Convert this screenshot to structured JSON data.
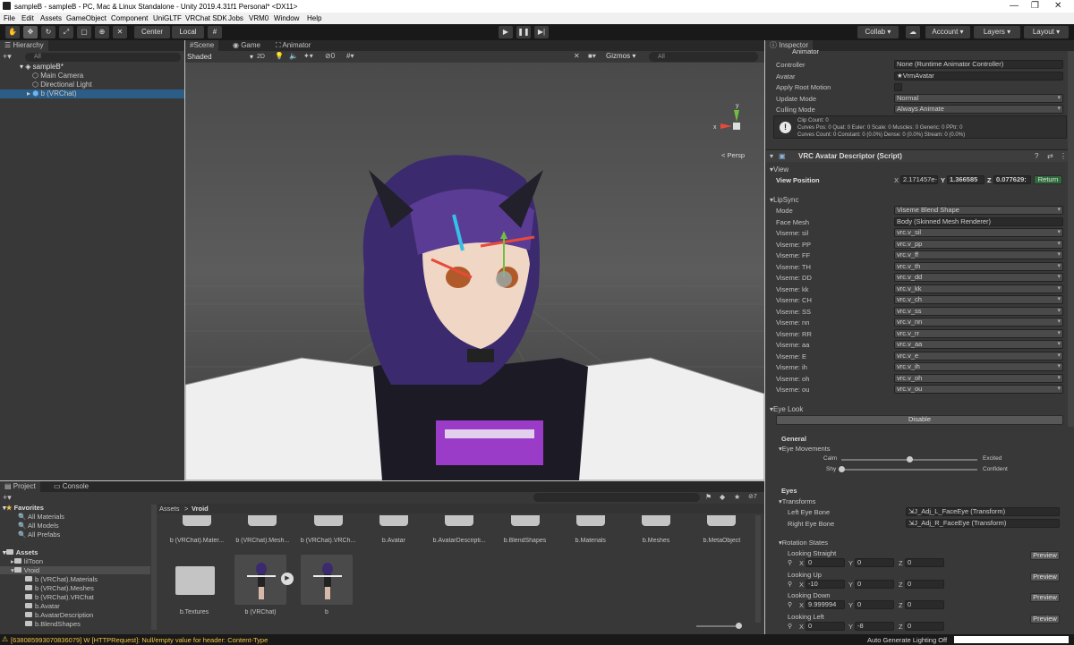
{
  "window": {
    "title": "sampleB - sampleB - PC, Mac & Linux Standalone - Unity 2019.4.31f1 Personal* <DX11>"
  },
  "menu": [
    "File",
    "Edit",
    "Assets",
    "GameObject",
    "Component",
    "UniGLTF",
    "VRChat SDK",
    "Jobs",
    "VRM0",
    "Window",
    "Help"
  ],
  "toolbar": {
    "center": "Center",
    "local": "Local",
    "collab": "Collab ▾",
    "account": "Account",
    "layers": "Layers",
    "layout": "Layout"
  },
  "hierarchy": {
    "tab": "Hierarchy",
    "search_placeholder": "All",
    "scene": "sampleB*",
    "items": [
      "Main Camera",
      "Directional Light",
      "b (VRChat)"
    ]
  },
  "scene_view": {
    "tabs": [
      "Scene",
      "Game",
      "Animator"
    ],
    "shading": "Shaded",
    "mode_2d": "2D",
    "layers_count": "0",
    "gizmos": "Gizmos",
    "search_placeholder": "All",
    "persp": "< Persp",
    "axis_y": "y",
    "axis_x": "x"
  },
  "inspector": {
    "tab": "Inspector",
    "animator_header": "Animator",
    "animator": [
      {
        "label": "Controller",
        "value": "None (Runtime Animator Controller)"
      },
      {
        "label": "Avatar",
        "value": "VrmAvatar"
      },
      {
        "label": "Apply Root Motion",
        "value": ""
      },
      {
        "label": "Update Mode",
        "value": "Normal"
      },
      {
        "label": "Culling Mode",
        "value": "Always Animate"
      }
    ],
    "info_lines": [
      "Clip Count: 0",
      "Curves Pos: 0 Quat: 0 Euler: 0 Scale: 0 Muscles: 0 Generic: 0 PPtr: 0",
      "Curves Count: 0 Constant: 0 (0.0%) Dense: 0 (0.0%) Stream: 0 (0.0%)"
    ],
    "descriptor_title": "VRC Avatar Descriptor (Script)",
    "view_section": "View",
    "view_position_label": "View Position",
    "view_position": {
      "x": "2.171457e-",
      "y": "1.366585",
      "z": "0.077629:"
    },
    "return_label": "Return",
    "lipsync_section": "LipSync",
    "lipsync": [
      {
        "label": "Mode",
        "value": "Viseme Blend Shape"
      },
      {
        "label": "Face Mesh",
        "value": "Body (Skinned Mesh Renderer)"
      },
      {
        "label": "Viseme: sil",
        "value": "vrc.v_sil"
      },
      {
        "label": "Viseme: PP",
        "value": "vrc.v_pp"
      },
      {
        "label": "Viseme: FF",
        "value": "vrc.v_ff"
      },
      {
        "label": "Viseme: TH",
        "value": "vrc.v_th"
      },
      {
        "label": "Viseme: DD",
        "value": "vrc.v_dd"
      },
      {
        "label": "Viseme: kk",
        "value": "vrc.v_kk"
      },
      {
        "label": "Viseme: CH",
        "value": "vrc.v_ch"
      },
      {
        "label": "Viseme: SS",
        "value": "vrc.v_ss"
      },
      {
        "label": "Viseme: nn",
        "value": "vrc.v_nn"
      },
      {
        "label": "Viseme: RR",
        "value": "vrc.v_rr"
      },
      {
        "label": "Viseme: aa",
        "value": "vrc.v_aa"
      },
      {
        "label": "Viseme: E",
        "value": "vrc.v_e"
      },
      {
        "label": "Viseme: ih",
        "value": "vrc.v_ih"
      },
      {
        "label": "Viseme: oh",
        "value": "vrc.v_oh"
      },
      {
        "label": "Viseme: ou",
        "value": "vrc.v_ou"
      }
    ],
    "eyelook_section": "Eye Look",
    "disable_label": "Disable",
    "general_label": "General",
    "eye_movements_label": "Eye Movements",
    "calm": "Calm",
    "excited": "Excited",
    "shy": "Shy",
    "confident": "Confident",
    "calm_excited_value": 0.5,
    "shy_confident_value": 0.0,
    "eyes_label": "Eyes",
    "transforms_label": "Transforms",
    "left_eye_label": "Left Eye Bone",
    "left_eye_value": "J_Adj_L_FaceEye (Transform)",
    "right_eye_label": "Right Eye Bone",
    "right_eye_value": "J_Adj_R_FaceEye (Transform)",
    "rotation_states_label": "Rotation States",
    "rotation_states": [
      {
        "label": "Looking Straight",
        "x": "0",
        "y": "0",
        "z": "0"
      },
      {
        "label": "Looking Up",
        "x": "-10",
        "y": "0",
        "z": "0"
      },
      {
        "label": "Looking Down",
        "x": "9.999994",
        "y": "0",
        "z": "0"
      },
      {
        "label": "Looking Left",
        "x": "0",
        "y": "-8",
        "z": "0"
      }
    ],
    "preview_label": "Preview"
  },
  "project": {
    "tabs": [
      "Project",
      "Console"
    ],
    "favorites": "Favorites",
    "fav_items": [
      "All Materials",
      "All Models",
      "All Prefabs"
    ],
    "assets": "Assets",
    "tree": [
      "lilToon",
      "Vroid",
      "b (VRChat).Materials",
      "b (VRChat).Meshes",
      "b (VRChat).VRChat",
      "b.Avatar",
      "b.AvatarDescription",
      "b.BlendShapes"
    ],
    "breadcrumb_root": "Assets",
    "breadcrumb_leaf": "Vroid",
    "hidden_count": "7",
    "top_row": [
      "b (VRChat).Mater...",
      "b (VRChat).Mesh...",
      "b (VRChat).VRCh...",
      "b.Avatar",
      "b.AvatarDescripti...",
      "b.BlendShapes",
      "b.Materials",
      "b.Meshes",
      "b.MetaObject"
    ],
    "bottom_row": [
      "b.Textures",
      "b (VRChat)",
      "b"
    ]
  },
  "status": {
    "message": "[638085993070836079] W [HTTPRequest]: Null/empty value for header: Content-Type",
    "lighting": "Auto Generate Lighting Off"
  },
  "colors": {
    "accent": "#2c5d87",
    "warning": "#f4c542",
    "return_btn": "#2e6b3a"
  }
}
